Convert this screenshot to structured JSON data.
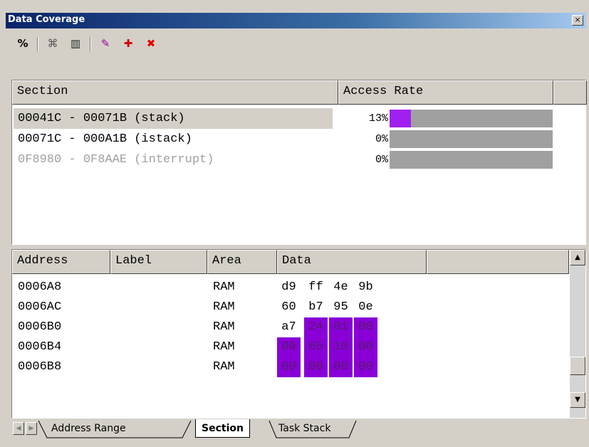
{
  "window": {
    "title": "Data Coverage",
    "close": "×"
  },
  "toolbar": {
    "buttons": [
      {
        "name": "percent-icon",
        "glyph": "%"
      },
      {
        "name": "radar-icon",
        "glyph": "⌘"
      },
      {
        "name": "memory-icon",
        "glyph": "▥"
      },
      {
        "name": "broom-icon",
        "glyph": "✎"
      },
      {
        "name": "add-item-icon",
        "glyph": "✚"
      },
      {
        "name": "delete-item-icon",
        "glyph": "✖"
      }
    ]
  },
  "sections": {
    "headers": {
      "section": "Section",
      "access_rate": "Access Rate"
    },
    "rows": [
      {
        "range": "00041C - 00071B (stack)",
        "pct": "13%",
        "rate": 0.13
      },
      {
        "range": "00071C - 000A1B (istack)",
        "pct": "0%",
        "rate": 0
      },
      {
        "range": "0F8980 - 0F8AAE (interrupt)",
        "pct": "0%",
        "rate": 0
      }
    ]
  },
  "memory": {
    "headers": {
      "address": "Address",
      "label": "Label",
      "area": "Area",
      "data": "Data"
    },
    "rows": [
      {
        "address": "0006A8",
        "label": "",
        "area": "RAM",
        "bytes": [
          "d9",
          "ff",
          "4e",
          "9b"
        ],
        "hl": [
          false,
          false,
          false,
          false
        ]
      },
      {
        "address": "0006AC",
        "label": "",
        "area": "RAM",
        "bytes": [
          "60",
          "b7",
          "95",
          "0e"
        ],
        "hl": [
          false,
          false,
          false,
          false
        ]
      },
      {
        "address": "0006B0",
        "label": "",
        "area": "RAM",
        "bytes": [
          "a7",
          "24",
          "01",
          "00"
        ],
        "hl": [
          false,
          true,
          true,
          true
        ]
      },
      {
        "address": "0006B4",
        "label": "",
        "area": "RAM",
        "bytes": [
          "00",
          "65",
          "10",
          "00"
        ],
        "hl": [
          true,
          true,
          true,
          true
        ]
      },
      {
        "address": "0006B8",
        "label": "",
        "area": "RAM",
        "bytes": [
          "00",
          "00",
          "00",
          "00"
        ],
        "hl": [
          true,
          true,
          true,
          true
        ]
      }
    ]
  },
  "tabs": [
    {
      "label": "Address Range",
      "active": false
    },
    {
      "label": "Section",
      "active": true
    },
    {
      "label": "Task Stack",
      "active": false
    }
  ],
  "colors": {
    "coverage_fill": "#a020f0",
    "bar_bg": "#a0a0a0",
    "highlight": "#8800d6"
  }
}
